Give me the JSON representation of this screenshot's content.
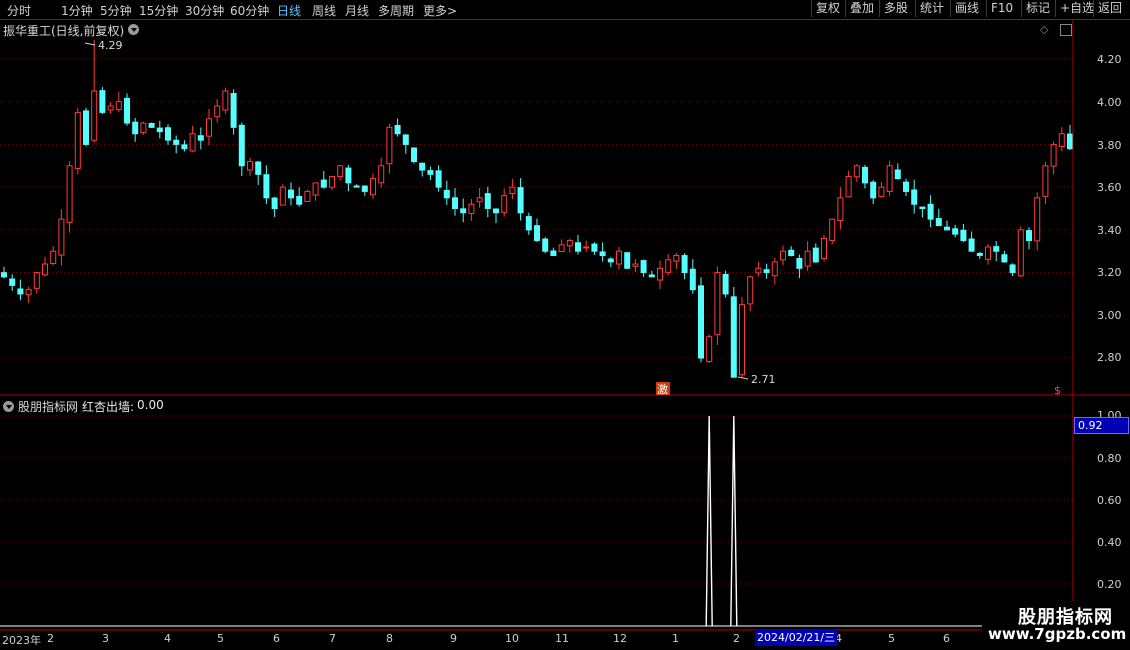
{
  "toolbar": {
    "periods": [
      "分时",
      "1分钟",
      "5分钟",
      "15分钟",
      "30分钟",
      "60分钟",
      "日线",
      "周线",
      "月线",
      "多周期",
      "更多"
    ],
    "active_period": "日线",
    "more_arrow": ">",
    "right_buttons": [
      "复权",
      "叠加",
      "多股",
      "统计",
      "画线",
      "F10",
      "标记",
      "+自选",
      "返回"
    ]
  },
  "main_chart": {
    "title": "振华重工(日线,前复权)",
    "y_ticks": [
      "4.20",
      "4.00",
      "3.80",
      "3.60",
      "3.40",
      "3.20",
      "3.00",
      "2.80"
    ],
    "high_label": "4.29",
    "low_label": "2.71",
    "signal_tag": "激",
    "dollar_tag": "$"
  },
  "indicator": {
    "title": "股朋指标网",
    "line_label": "红杏出墙:",
    "line_value": "0.00",
    "y_ticks": [
      "1.00",
      "0.80",
      "0.60",
      "0.40",
      "0.20"
    ],
    "current_value": "0.92"
  },
  "x_axis": {
    "labels": [
      "2023年",
      "2",
      "3",
      "4",
      "5",
      "6",
      "7",
      "8",
      "9",
      "10",
      "11",
      "12",
      "1",
      "2",
      "4",
      "5",
      "6"
    ],
    "cursor_date": "2024/02/21/三"
  },
  "watermark": {
    "title": "股朋指标网",
    "url": "www.7gpzb.com"
  },
  "colors": {
    "up": "#ff3a3a",
    "down": "#54ffff",
    "grid": "#7a0000",
    "axis": "#b00000",
    "highlight_bg": "#0000b4"
  },
  "chart_data": {
    "type": "candlestick",
    "title": "振华重工(日线,前复权)",
    "ylim": [
      2.7,
      4.3
    ],
    "max_price": 4.29,
    "min_price": 2.71,
    "closes": [
      3.18,
      3.14,
      3.1,
      3.12,
      3.2,
      3.24,
      3.3,
      3.45,
      3.7,
      3.95,
      3.8,
      4.05,
      3.95,
      3.98,
      4.0,
      3.9,
      3.85,
      3.9,
      3.88,
      3.86,
      3.82,
      3.8,
      3.78,
      3.85,
      3.82,
      3.92,
      3.98,
      4.05,
      3.88,
      3.7,
      3.72,
      3.66,
      3.55,
      3.5,
      3.6,
      3.55,
      3.52,
      3.58,
      3.62,
      3.6,
      3.65,
      3.7,
      3.62,
      3.6,
      3.58,
      3.64,
      3.7,
      3.88,
      3.85,
      3.8,
      3.72,
      3.68,
      3.66,
      3.6,
      3.55,
      3.5,
      3.48,
      3.52,
      3.55,
      3.5,
      3.48,
      3.56,
      3.6,
      3.48,
      3.4,
      3.35,
      3.3,
      3.28,
      3.33,
      3.35,
      3.3,
      3.32,
      3.3,
      3.28,
      3.25,
      3.3,
      3.22,
      3.24,
      3.2,
      3.18,
      3.22,
      3.26,
      3.28,
      3.2,
      3.12,
      2.8,
      2.9,
      3.2,
      3.1,
      2.71,
      3.05,
      3.18,
      3.22,
      3.2,
      3.25,
      3.3,
      3.28,
      3.22,
      3.3,
      3.25,
      3.36,
      3.45,
      3.55,
      3.65,
      3.7,
      3.62,
      3.55,
      3.6,
      3.7,
      3.64,
      3.58,
      3.52,
      3.5,
      3.45,
      3.42,
      3.4,
      3.38,
      3.35,
      3.3,
      3.28,
      3.32,
      3.3,
      3.25,
      3.2,
      3.4,
      3.35,
      3.55,
      3.7,
      3.8,
      3.85,
      3.78
    ],
    "indicator": {
      "name": "红杏出墙",
      "ylim": [
        0,
        1.0
      ],
      "spike_indices": [
        86,
        89
      ],
      "spike_value": 1.0
    }
  }
}
